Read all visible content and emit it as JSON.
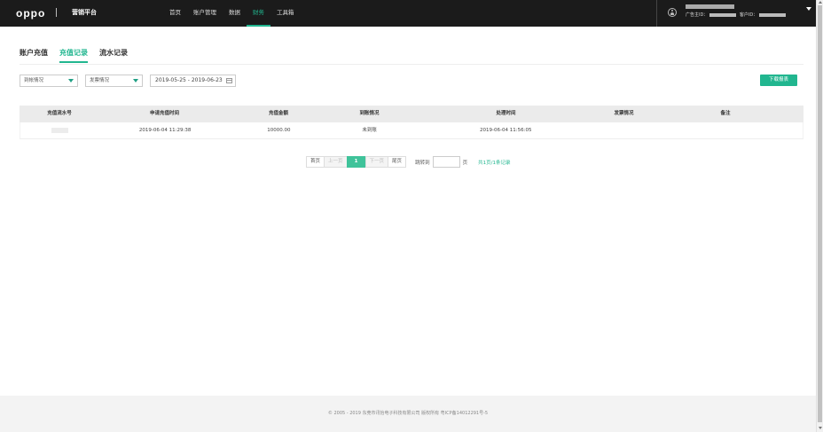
{
  "header": {
    "logo": "oppo",
    "platform": "营销平台",
    "nav": [
      {
        "label": "首页"
      },
      {
        "label": "账户管理"
      },
      {
        "label": "数据"
      },
      {
        "label": "财务"
      },
      {
        "label": "工具箱"
      }
    ],
    "active_nav": "财务",
    "advertiser_id_label": "广告主ID：",
    "customer_id_label": "客户ID："
  },
  "tabs": [
    {
      "label": "账户充值"
    },
    {
      "label": "充值记录"
    },
    {
      "label": "流水记录"
    }
  ],
  "active_tab": "充值记录",
  "filters": {
    "arrival_status": "到帐情况",
    "invoice_status": "发票情况",
    "date_range": "2019-05-25 - 2019-06-23",
    "download_label": "下载报表"
  },
  "table": {
    "columns": [
      "充值流水号",
      "申请充值时间",
      "充值金额",
      "到账情况",
      "处理时间",
      "发票情况",
      "备注"
    ],
    "rows": [
      {
        "serial": "",
        "apply_time": "2019-06-04 11:29:38",
        "amount": "10000.00",
        "arrival": "未到账",
        "process_time": "2019-06-04 11:56:05",
        "invoice": "",
        "remark": ""
      }
    ]
  },
  "pagination": {
    "first": "首页",
    "prev": "上一页",
    "current": "1",
    "next": "下一页",
    "last": "尾页",
    "jump_label": "跳转到",
    "page_unit": "页",
    "total": "共1页/1条记录"
  },
  "footer": {
    "copyright": "© 2005 - 2019 东莞市讯怡电子科技有限公司 版权所有 粤ICP备14012291号-5"
  },
  "colors": {
    "accent": "#21b68f",
    "header_bg": "#1b1b1b",
    "table_header_bg": "#ebebeb",
    "footer_bg": "#f3f3f3"
  }
}
